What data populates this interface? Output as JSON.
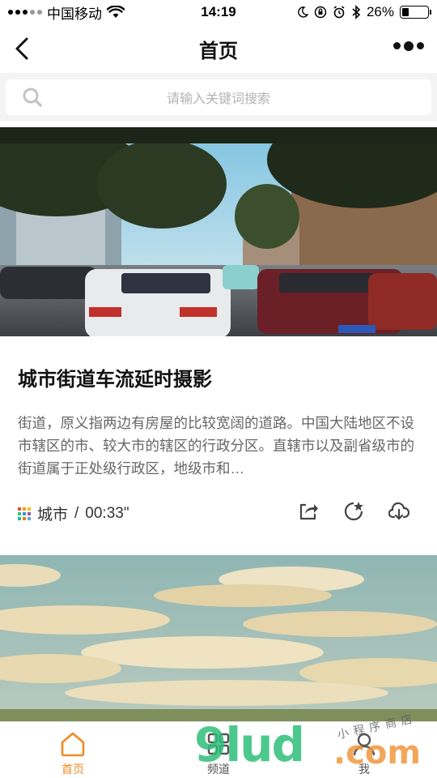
{
  "status_bar": {
    "carrier": "中国移动",
    "time": "14:19",
    "battery": "26%",
    "battery_level": 0.26
  },
  "nav": {
    "title": "首页"
  },
  "search": {
    "placeholder": "请输入关键词搜索"
  },
  "feed": [
    {
      "title": "城市街道车流延时摄影",
      "description": "街道，原义指两边有房屋的比较宽阔的道路。中国大陆地区不设市辖区的市、较大市的辖区的行政分区。直辖市以及副省级市的街道属于正处级行政区，地级市和…",
      "category": "城市",
      "separator": "/",
      "duration": "00:33\"",
      "image": "city street traffic with taxis and trees"
    },
    {
      "image": "sky with clouds over grassland"
    }
  ],
  "tabs": [
    {
      "label": "首页",
      "icon": "home-icon",
      "active": true
    },
    {
      "label": "频道",
      "icon": "channel-grid-icon",
      "active": false
    },
    {
      "label": "我",
      "icon": "user-icon",
      "active": false
    }
  ],
  "watermark": {
    "brand": "9lud",
    "domain": ".com",
    "caption": "小程序商店"
  },
  "colors": {
    "accent": "#f08a24",
    "placeholder": "#b3b3b3",
    "description": "#666666"
  }
}
